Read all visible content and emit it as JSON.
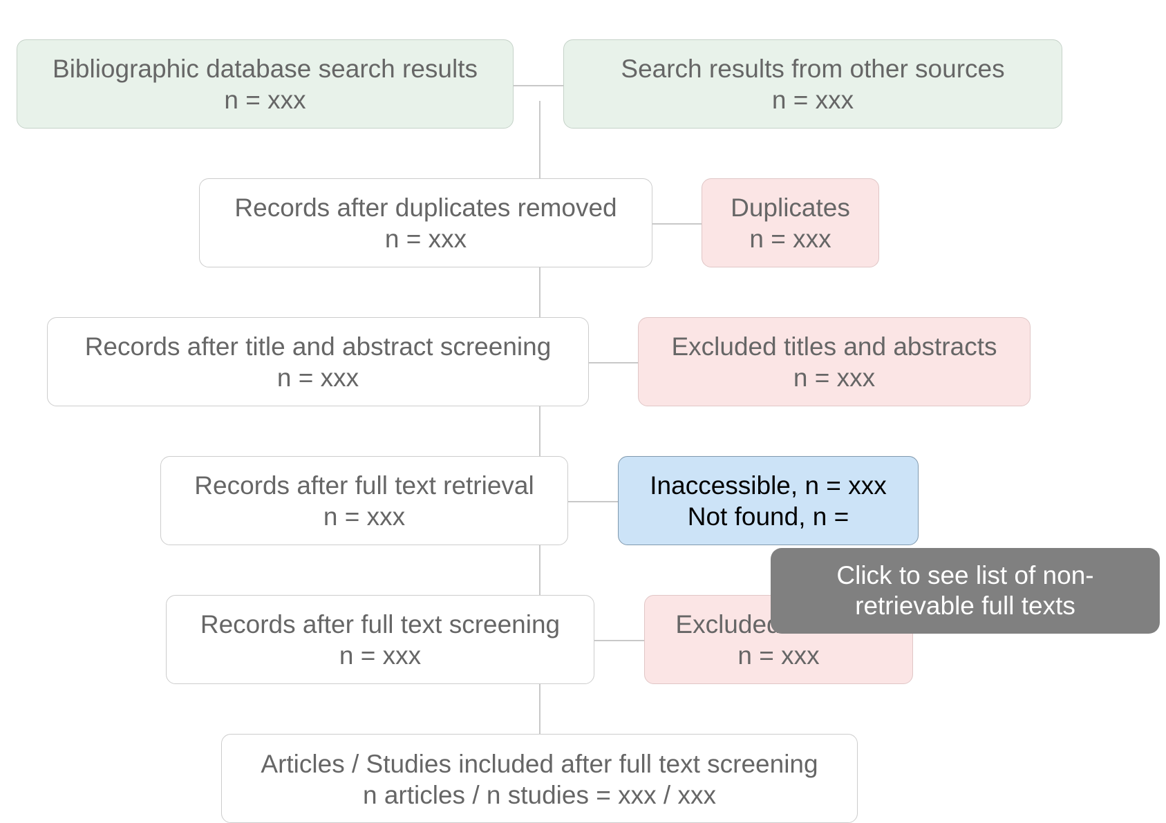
{
  "colors": {
    "source": "#e8f2ea",
    "excluded": "#fbe5e5",
    "selected": "#cce3f7",
    "tooltip": "#808080"
  },
  "boxes": {
    "db_search": {
      "title": "Bibliographic database search results",
      "count": "n = xxx"
    },
    "other_sources": {
      "title": "Search results from other sources",
      "count": "n = xxx"
    },
    "after_duplicates": {
      "title": "Records after duplicates removed",
      "count": "n = xxx"
    },
    "duplicates": {
      "title": "Duplicates",
      "count": "n = xxx"
    },
    "after_title_abstract": {
      "title": "Records after title and abstract screening",
      "count": "n = xxx"
    },
    "excluded_titles": {
      "title": "Excluded titles and abstracts",
      "count": "n = xxx"
    },
    "after_retrieval": {
      "title": "Records after full text retrieval",
      "count": "n = xxx"
    },
    "inaccessible": {
      "line1": "Inaccessible, n = xxx",
      "line2": "Not found, n ="
    },
    "after_full_text": {
      "title": "Records after full text screening",
      "count": "n = xxx"
    },
    "excluded_full_texts": {
      "title": "Excluded full texts",
      "count": "n = xxx"
    },
    "included": {
      "title": "Articles / Studies included after full text screening",
      "count": "n articles / n studies = xxx / xxx"
    }
  },
  "tooltip": {
    "text": "Click to see list of non-retrievable full texts"
  }
}
